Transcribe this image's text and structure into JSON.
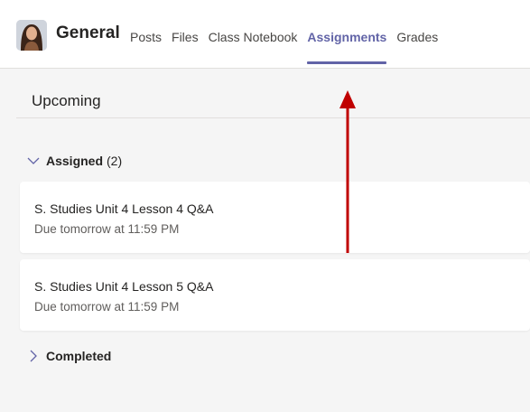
{
  "header": {
    "team_name": "General",
    "tabs": [
      {
        "label": "Posts",
        "active": false
      },
      {
        "label": "Files",
        "active": false
      },
      {
        "label": "Class Notebook",
        "active": false
      },
      {
        "label": "Assignments",
        "active": true
      },
      {
        "label": "Grades",
        "active": false
      }
    ]
  },
  "section": {
    "title": "Upcoming"
  },
  "assigned": {
    "label": "Assigned",
    "count": "(2)",
    "expanded": true,
    "items": [
      {
        "title": "S. Studies Unit 4 Lesson 4 Q&A",
        "due": "Due tomorrow at 11:59 PM"
      },
      {
        "title": "S. Studies Unit 4 Lesson 5 Q&A",
        "due": "Due tomorrow at 11:59 PM"
      }
    ]
  },
  "completed": {
    "label": "Completed",
    "expanded": false
  },
  "colors": {
    "accent": "#6264a7",
    "annotation_arrow": "#c00000",
    "background": "#f5f5f5",
    "card": "#ffffff"
  },
  "icons": {
    "assigned_toggle": "chevron-down-icon",
    "completed_toggle": "chevron-right-icon",
    "annotation": "arrow-up-icon"
  }
}
